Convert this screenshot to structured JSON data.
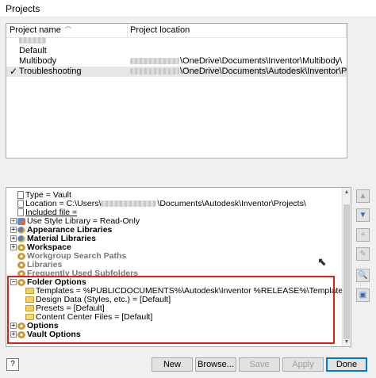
{
  "window": {
    "title": "Projects"
  },
  "projects_table": {
    "columns": {
      "name": "Project name",
      "location": "Project location"
    },
    "rows": [
      {
        "name": "",
        "location": "",
        "checked": false,
        "selected": false
      },
      {
        "name": "Default",
        "location": "",
        "checked": false,
        "selected": false
      },
      {
        "name": "Multibody",
        "location": "\\OneDrive\\Documents\\Inventor\\Multibody\\",
        "checked": false,
        "selected": false
      },
      {
        "name": "Troubleshooting",
        "location": "\\OneDrive\\Documents\\Autodesk\\Inventor\\Projects\\",
        "checked": true,
        "selected": true
      }
    ],
    "check_glyph": "✓"
  },
  "tree": {
    "type_label": "Type = Vault",
    "location_prefix": "Location = C:\\Users\\",
    "location_suffix": "\\Documents\\Autodesk\\Inventor\\Projects\\",
    "included_file": "Included file =",
    "use_style_library": "Use Style Library = Read-Only",
    "appearance_libraries": "Appearance Libraries",
    "material_libraries": "Material Libraries",
    "workspace": "Workspace",
    "workgroup_search_paths": "Workgroup Search Paths",
    "libraries": "Libraries",
    "frequently_used_subfolders": "Frequently Used Subfolders",
    "folder_options": "Folder Options",
    "templates": "Templates = %PUBLICDOCUMENTS%\\Autodesk\\Inventor %RELEASE%\\Templates\\%LANGUAGE%\\Metric\\",
    "design_data": "Design Data (Styles, etc.) = [Default]",
    "presets": "Presets = [Default]",
    "content_center_files": "Content Center Files = [Default]",
    "options": "Options",
    "vault_options": "Vault Options",
    "expand_glyph": "+",
    "collapse_glyph": "−"
  },
  "side_buttons": {
    "up": "▲",
    "down": "▼",
    "add": "+",
    "edit": "✎",
    "find": "🔍",
    "save": "▣"
  },
  "buttons": {
    "help": "?",
    "new": "New",
    "browse": "Browse...",
    "save": "Save",
    "apply": "Apply",
    "done": "Done"
  },
  "colors": {
    "highlight": "#e02020",
    "accent": "#0078d7"
  }
}
